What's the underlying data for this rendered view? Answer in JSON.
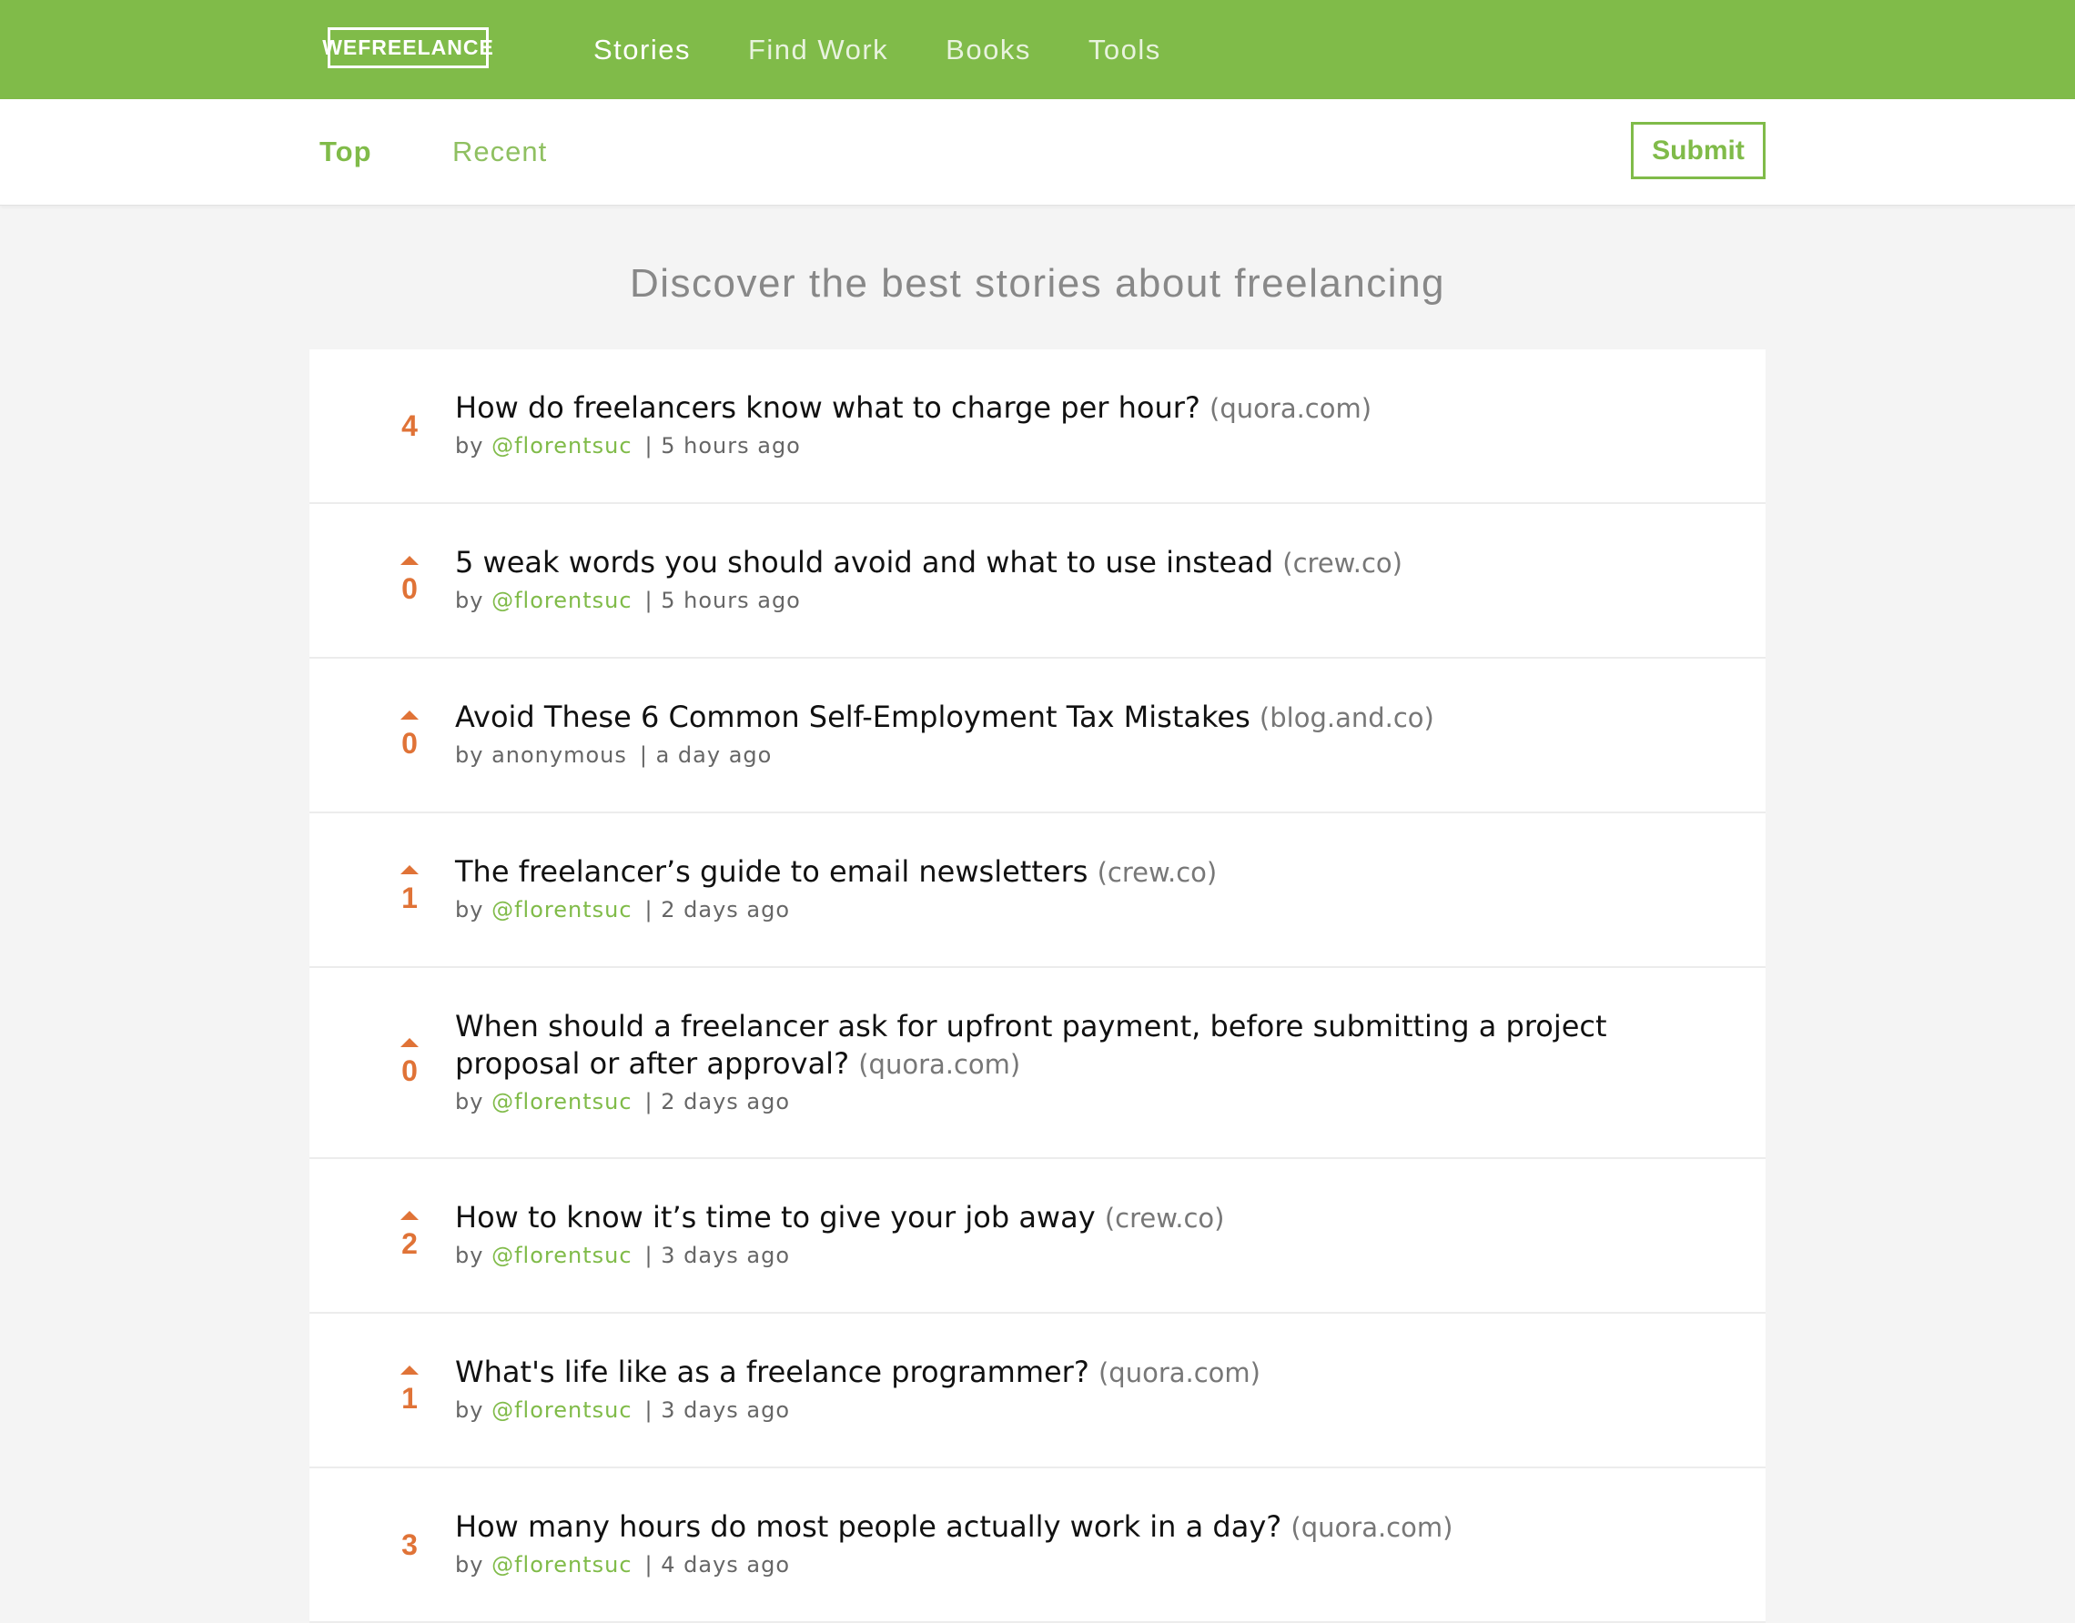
{
  "header": {
    "logo": "WEFREELANCE",
    "nav": [
      {
        "label": "Stories"
      },
      {
        "label": "Find Work"
      },
      {
        "label": "Books"
      },
      {
        "label": "Tools"
      }
    ]
  },
  "subnav": {
    "tabs": [
      {
        "label": "Top"
      },
      {
        "label": "Recent"
      }
    ],
    "submit_label": "Submit"
  },
  "page_heading": "Discover the best stories about freelancing",
  "meta_prefix": "by",
  "stories": [
    {
      "votes": "4",
      "title": "How do freelancers know what to charge per hour?",
      "domain": "(quora.com)",
      "author": "@florentsuc",
      "time": "| 5 hours ago",
      "voted": true
    },
    {
      "votes": "0",
      "title": "5 weak words you should avoid and what to use instead",
      "domain": "(crew.co)",
      "author": "@florentsuc",
      "time": "| 5 hours ago",
      "voted": false
    },
    {
      "votes": "0",
      "title": "Avoid These 6 Common Self-Employment Tax Mistakes",
      "domain": "(blog.and.co)",
      "author": "anonymous",
      "time": "| a day ago",
      "voted": false
    },
    {
      "votes": "1",
      "title": "The freelancer’s guide to email newsletters",
      "domain": "(crew.co)",
      "author": "@florentsuc",
      "time": "| 2 days ago",
      "voted": false
    },
    {
      "votes": "0",
      "title": "When should a freelancer ask for upfront payment, before submitting a project proposal or after approval?",
      "domain": "(quora.com)",
      "author": "@florentsuc",
      "time": "| 2 days ago",
      "voted": false
    },
    {
      "votes": "2",
      "title": "How to know it’s time to give your job away",
      "domain": "(crew.co)",
      "author": "@florentsuc",
      "time": "| 3 days ago",
      "voted": false
    },
    {
      "votes": "1",
      "title": "What's life like as a freelance programmer?",
      "domain": "(quora.com)",
      "author": "@florentsuc",
      "time": "| 3 days ago",
      "voted": false
    },
    {
      "votes": "3",
      "title": "How many hours do most people actually work in a day?",
      "domain": "(quora.com)",
      "author": "@florentsuc",
      "time": "| 4 days ago",
      "voted": true
    }
  ],
  "colors": {
    "brand_green": "#80bb49",
    "vote_orange": "#e07337",
    "background": "#f4f4f4"
  }
}
